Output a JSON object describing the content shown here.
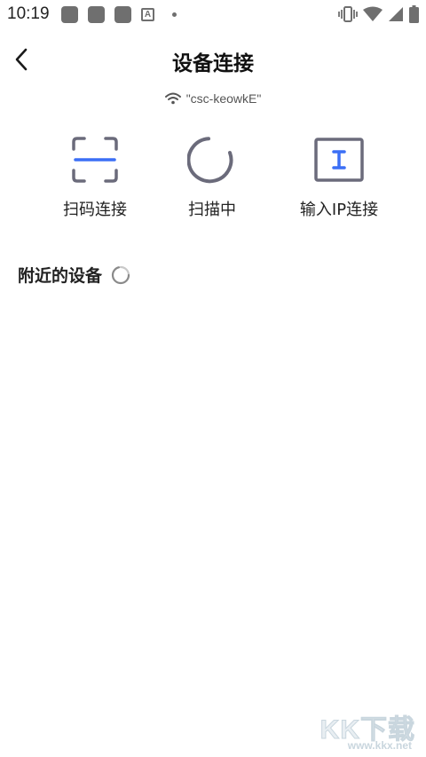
{
  "status_bar": {
    "time": "10:19",
    "notification_icons": [
      "app-notification-icon",
      "app-notification-icon",
      "app-notification-icon",
      "text-a-icon",
      "dot-icon"
    ],
    "a_badge": "A",
    "system_icons": [
      "vibrate-icon",
      "wifi-icon",
      "signal-icon",
      "battery-icon"
    ]
  },
  "header": {
    "title": "设备连接",
    "back_icon": "chevron-left-icon"
  },
  "network": {
    "icon": "wifi-icon",
    "ssid": "\"csc-keowkE\""
  },
  "actions": [
    {
      "label": "扫码连接",
      "icon": "scan-frame-icon"
    },
    {
      "label": "扫描中",
      "icon": "loading-ring-icon"
    },
    {
      "label": "输入IP连接",
      "icon": "text-input-icon"
    }
  ],
  "nearby": {
    "title": "附近的设备",
    "icon": "spinner-icon"
  },
  "watermark": {
    "big": "KK下载",
    "small": "www.kkx.net"
  },
  "colors": {
    "icon_gray": "#6b6b7b",
    "accent_blue": "#3b6ff5",
    "text": "#222222"
  }
}
